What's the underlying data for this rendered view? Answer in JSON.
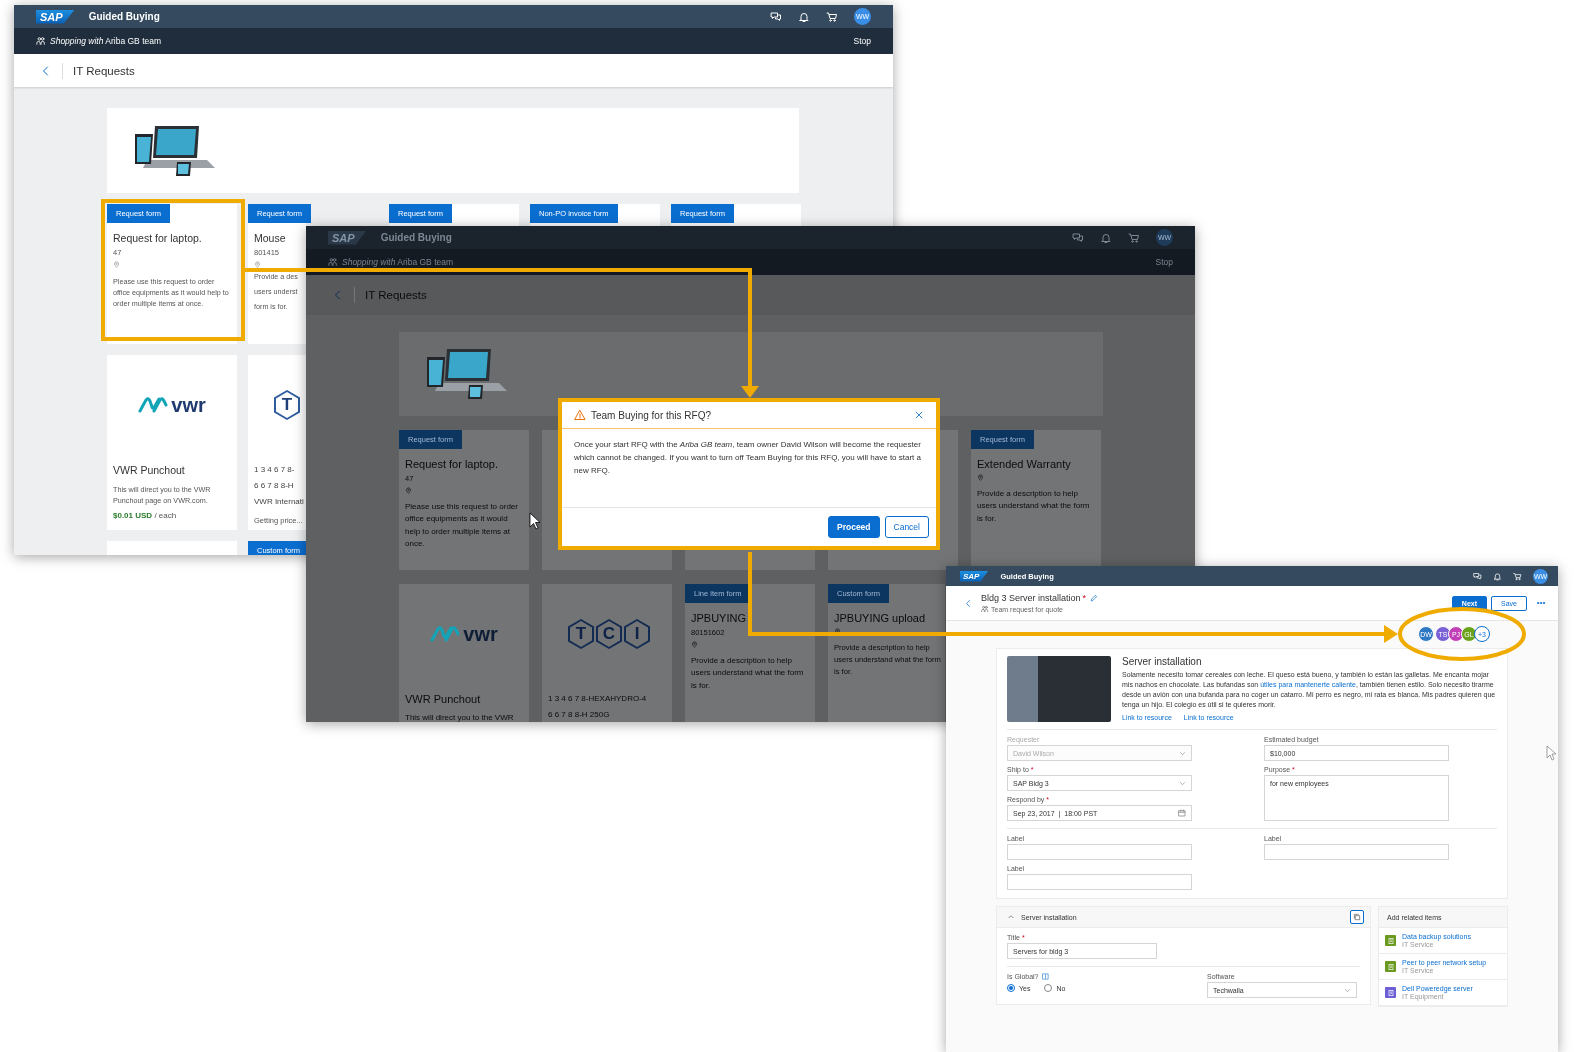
{
  "catalog_windows": [
    {
      "dimmed": false,
      "header": {
        "logo": "SAP",
        "app_title": "Guided Buying",
        "avatar": "WW"
      },
      "team_bar": {
        "text": "*Shopping with* Ariba GB team",
        "action": "Stop"
      },
      "page_title": "IT Requests",
      "rows": [
        {
          "cards": [
            {
              "kind": "form",
              "badge": "Request form",
              "title": "Request for laptop.",
              "number": "47",
              "pin": true,
              "description": "Please use this request to order office equipments as it would help to order multiple items at once."
            },
            {
              "kind": "form",
              "badge": "Request form",
              "title": "Mouse",
              "number": "801415",
              "pin": true,
              "lines": [
                "Provide a des",
                "users underst",
                "form is for."
              ]
            },
            {
              "kind": "form",
              "badge": "Request form"
            },
            {
              "kind": "form",
              "badge": "Non-PO invoice form"
            },
            {
              "kind": "form",
              "badge": "Request form"
            }
          ]
        },
        {
          "cards": [
            {
              "kind": "punchout",
              "logo_text": "vwr",
              "title": "VWR Punchout",
              "description": "This will direct you to the VWR Punchout page on VWR.com.",
              "price": "$0.01 USD",
              "unit": "/ each"
            },
            {
              "kind": "product",
              "logo_letters": [
                "T"
              ],
              "lines": [
                "1 3 4 6 7 8-",
                "6 6 7 8 8-H",
                "VWR Internati"
              ],
              "status": "Getting price..."
            }
          ]
        },
        {
          "cards": [
            {
              "kind": "blank"
            },
            {
              "kind": "form",
              "badge": "Custom form"
            }
          ]
        }
      ]
    },
    {
      "dimmed": true,
      "header": {
        "logo": "SAP",
        "app_title": "Guided Buying",
        "avatar": "WW"
      },
      "team_bar": {
        "text": "*Shopping with* Ariba GB team",
        "action": "Stop"
      },
      "page_title": "IT Requests",
      "rows": [
        {
          "cards": [
            {
              "kind": "form",
              "badge": "Request form",
              "title": "Request for laptop.",
              "number": "47",
              "pin": true,
              "description": "Please use this request to order office equipments as it would help to order multiple items at once."
            },
            {
              "kind": "blank"
            },
            {
              "kind": "blank"
            },
            {
              "kind": "blank"
            },
            {
              "kind": "form",
              "badge": "Request form",
              "title": "Extended Warranty",
              "pin": true,
              "description": "Provide a description to help users understand what the form is for."
            }
          ]
        },
        {
          "cards": [
            {
              "kind": "punchout",
              "logo_text": "vwr",
              "title": "VWR Punchout",
              "description": "This will direct you to the VWR"
            },
            {
              "kind": "product",
              "logo_letters": [
                "T",
                "C",
                "I"
              ],
              "lines": [
                "1 3 4 6 7 8-HEXAHYDRO-4",
                "6 6 7 8 8-H 250G"
              ]
            },
            {
              "kind": "form",
              "badge": "Line item form",
              "title": "JPBUYING",
              "number": "80151602",
              "pin": true,
              "description": "Provide a description to help users understand what the form is for."
            },
            {
              "kind": "form",
              "badge": "Custom form",
              "title": "JPBUYING upload",
              "pin": true,
              "description": "Provide a description to help users understand what the form is for."
            }
          ]
        }
      ]
    }
  ],
  "dialog": {
    "title": "Team Buying for this RFQ?",
    "message": "Once your start RFQ with the *Ariba GB team*, team owner David Wilson will become the requester which cannot be changed. If you want to turn off Team Buying for this RFQ, you will have to start a new RFQ.",
    "buttons": [
      {
        "label": "Proceed",
        "kind": "primary"
      },
      {
        "label": "Cancel",
        "kind": "secondary"
      }
    ]
  },
  "rfq_window": {
    "header": {
      "logo": "SAP",
      "app_title": "Guided Buying",
      "avatar": "WW"
    },
    "title": "Bldg 3 Server installation",
    "title_mark": "*",
    "subtitle": "Team request for quote",
    "actions": [
      {
        "label": "Next",
        "kind": "primary"
      },
      {
        "label": "Save",
        "kind": "secondary"
      }
    ],
    "team_avatars": [
      {
        "kind": "person",
        "initials": "DW",
        "color": "#2f79c4"
      },
      {
        "kind": "person",
        "initials": "TS",
        "color": "#7b61d6"
      },
      {
        "kind": "person",
        "initials": "PJ",
        "color": "#c13fb7"
      },
      {
        "kind": "person",
        "initials": "GL",
        "color": "#6aa21b"
      },
      {
        "kind": "more",
        "initials": "+3"
      }
    ],
    "intro": {
      "heading": "Server installation",
      "text_before": "Solamente necesito tomar cereales con leche. El queso está bueno, y también lo están las galletas. Me encanta mojar mis nachos en chocolate. Las bufandas son ",
      "link": "útiles para mantenerte caliente",
      "text_after": ", también tienen estilo. Solo necesito tirarme desde un avión con una bufanda para no coger un catarro. Mi perro es negro, mi rata es blanca. Mis padres quieren que tenga un hijo. El colegio es útil si te quieres morir.",
      "links": [
        "Link to resource",
        "Link to resource"
      ]
    },
    "left_fields": [
      {
        "label": "Requester",
        "kind": "select",
        "value": "David Wilson",
        "disabled": true
      },
      {
        "label": "Ship to",
        "required_mark": "*",
        "kind": "select",
        "value": "SAP Bldg 3",
        "disabled": false
      },
      {
        "label": "Respond by",
        "required_mark": "*",
        "kind": "date",
        "value": "Sep 23, 2017  |  18:00 PST",
        "disabled": false
      }
    ],
    "right_fields": [
      {
        "label": "Estimated budget",
        "kind": "text",
        "value": "$10,000",
        "disabled": false
      },
      {
        "label": "Purpose",
        "required_mark": "*",
        "kind": "textarea",
        "value": "for new employees",
        "disabled": false
      }
    ],
    "extra_fields": [
      {
        "label": "Label",
        "kind": "text"
      },
      {
        "label": "Label",
        "kind": "text"
      },
      {
        "label": "Label",
        "kind": "text"
      }
    ],
    "section": {
      "title": "Server installation",
      "expanded": true,
      "fields": [
        {
          "label": "Title",
          "required_mark": "*",
          "kind": "text",
          "value": "Servers for bldg 3"
        }
      ],
      "is_global": {
        "label": "Is Global?",
        "options": [
          {
            "label": "Yes",
            "selected": true
          },
          {
            "label": "No",
            "selected": false
          }
        ]
      },
      "software": {
        "label": "Software",
        "kind": "select",
        "value": "Techwalla"
      }
    },
    "related": {
      "title": "Add related items",
      "items": [
        {
          "name": "Data backup solutions",
          "category": "IT Service",
          "color": "#6a9a1f"
        },
        {
          "name": "Peer to peer network setup",
          "category": "IT Service",
          "color": "#6a9a1f"
        },
        {
          "name": "Dell Poweredge server",
          "category": "IT Equipment",
          "color": "#6c5fd6"
        }
      ]
    }
  }
}
